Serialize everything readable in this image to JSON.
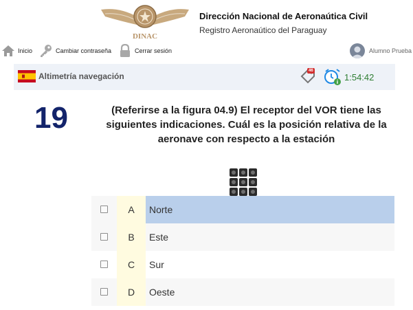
{
  "header": {
    "logo_text": "DINAC",
    "org_title": "Dirección Nacional de Aeronaútica Civil",
    "org_subtitle": "Registro Aeronaútico del Paraguay"
  },
  "nav": {
    "items": [
      {
        "label": "Inicio",
        "icon": "home-icon"
      },
      {
        "label": "Cambiar contraseña",
        "icon": "key-icon"
      },
      {
        "label": "Cerrar sesión",
        "icon": "lock-icon"
      }
    ],
    "user_name": "Alumno Prueba"
  },
  "subject": {
    "name": "Altimetría navegación",
    "flag": "spain-flag-icon",
    "badge_count": "46",
    "timer": "1:54:42"
  },
  "question": {
    "number": "19",
    "text": "(Referirse a la figura 04.9) El receptor del VOR tiene las siguientes indicaciones. Cuál es la posición relativa de la aeronave con respecto a la estación"
  },
  "options": [
    {
      "letter": "A",
      "text": "Norte",
      "selected": true
    },
    {
      "letter": "B",
      "text": "Este",
      "selected": false
    },
    {
      "letter": "C",
      "text": "Sur",
      "selected": false
    },
    {
      "letter": "D",
      "text": "Oeste",
      "selected": false
    }
  ],
  "colors": {
    "question_number": "#13246b",
    "timer": "#2e7d32",
    "selected_option": "#b9cfeb",
    "letter_column": "#fffbe0",
    "subject_bar": "#eef2f8"
  }
}
